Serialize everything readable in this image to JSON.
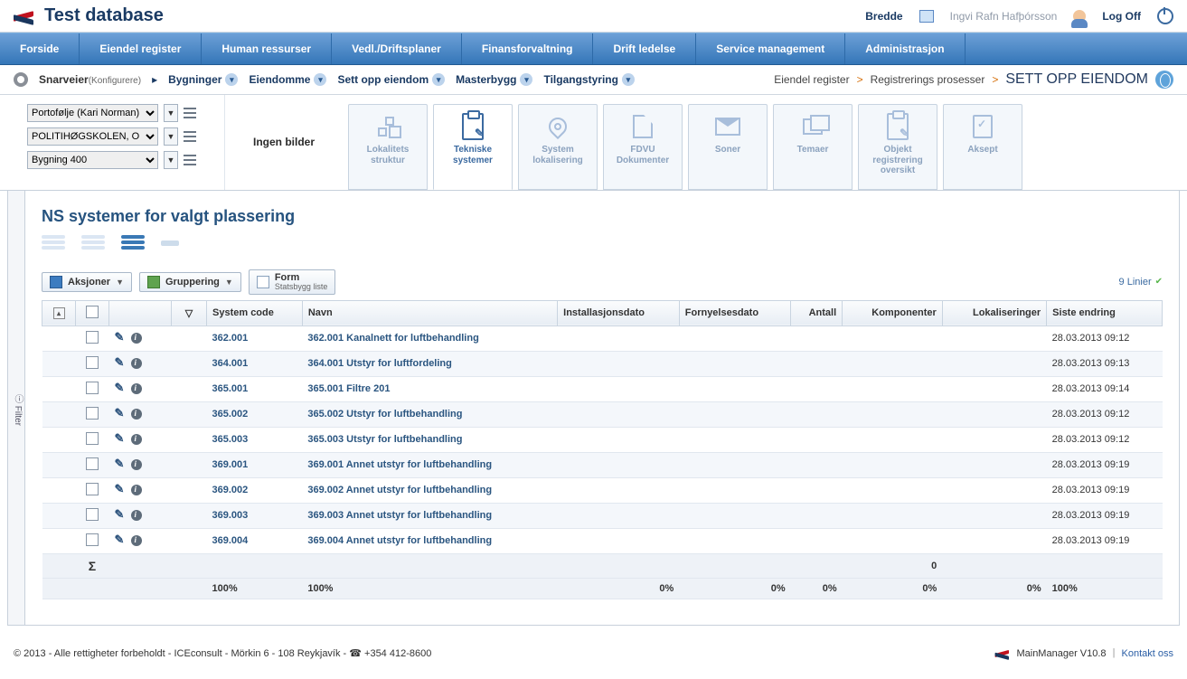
{
  "header": {
    "title": "Test database",
    "bredde": "Bredde",
    "user": "Ingvi Rafn Hafþórsson",
    "logoff": "Log Off"
  },
  "mainnav": [
    "Forside",
    "Eiendel register",
    "Human ressurser",
    "Vedl./Driftsplaner",
    "Finansforvaltning",
    "Drift ledelse",
    "Service management",
    "Administrasjon"
  ],
  "subbar": {
    "shortcut_label": "Snarveier",
    "konf": "(Konfigurere)",
    "items": [
      "Bygninger",
      "Eiendomme",
      "Sett opp eiendom",
      "Masterbygg",
      "Tilgangstyring"
    ],
    "bc1": "Eiendel register",
    "bc2": "Registrerings prosesser",
    "bc3": "SETT OPP EIENDOM"
  },
  "selectors": {
    "portfolio": "Portofølje (Kari Norman)",
    "site": "POLITIHØGSKOLEN, O",
    "building": "Bygning 400"
  },
  "nobilder": "Ingen bilder",
  "tabs": [
    {
      "label": "Lokalitets struktur"
    },
    {
      "label": "Tekniske systemer"
    },
    {
      "label": "System lokalisering"
    },
    {
      "label": "FDVU Dokumenter"
    },
    {
      "label": "Soner"
    },
    {
      "label": "Temaer"
    },
    {
      "label": "Objekt registrering oversikt"
    },
    {
      "label": "Aksept"
    }
  ],
  "filter_label": "Filter",
  "panel_title": "NS systemer for valgt plassering",
  "toolbar": {
    "aksjoner": "Aksjoner",
    "gruppering": "Gruppering",
    "form": "Form",
    "form_sub": "Statsbygg liste",
    "linier": "9 Linier"
  },
  "columns": {
    "code": "System code",
    "navn": "Navn",
    "inst": "Installasjonsdato",
    "forny": "Fornyelsesdato",
    "antall": "Antall",
    "komp": "Komponenter",
    "lokal": "Lokaliseringer",
    "siste": "Siste endring"
  },
  "rows": [
    {
      "code": "362.001",
      "navn": "362.001 Kanalnett for luftbehandling",
      "siste": "28.03.2013 09:12"
    },
    {
      "code": "364.001",
      "navn": "364.001 Utstyr for luftfordeling",
      "siste": "28.03.2013 09:13"
    },
    {
      "code": "365.001",
      "navn": "365.001 Filtre 201",
      "siste": "28.03.2013 09:14"
    },
    {
      "code": "365.002",
      "navn": "365.002 Utstyr for luftbehandling",
      "siste": "28.03.2013 09:12"
    },
    {
      "code": "365.003",
      "navn": "365.003 Utstyr for luftbehandling",
      "siste": "28.03.2013 09:12"
    },
    {
      "code": "369.001",
      "navn": "369.001 Annet utstyr for luftbehandling",
      "siste": "28.03.2013 09:19"
    },
    {
      "code": "369.002",
      "navn": "369.002 Annet utstyr for luftbehandling",
      "siste": "28.03.2013 09:19"
    },
    {
      "code": "369.003",
      "navn": "369.003 Annet utstyr for luftbehandling",
      "siste": "28.03.2013 09:19"
    },
    {
      "code": "369.004",
      "navn": "369.004 Annet utstyr for luftbehandling",
      "siste": "28.03.2013 09:19"
    }
  ],
  "totals": {
    "komp_sum": "0",
    "code": "100%",
    "navn": "100%",
    "inst": "0%",
    "forny": "0%",
    "antall": "0%",
    "komp": "0%",
    "lokal": "0%",
    "siste": "100%"
  },
  "footer": {
    "left": "© 2013 - Alle rettigheter forbeholdt - ICEconsult - Mörkin 6 - 108 Reykjavík - ☎ +354 412-8600",
    "version": "MainManager V10.8",
    "kontakt": "Kontakt oss"
  }
}
